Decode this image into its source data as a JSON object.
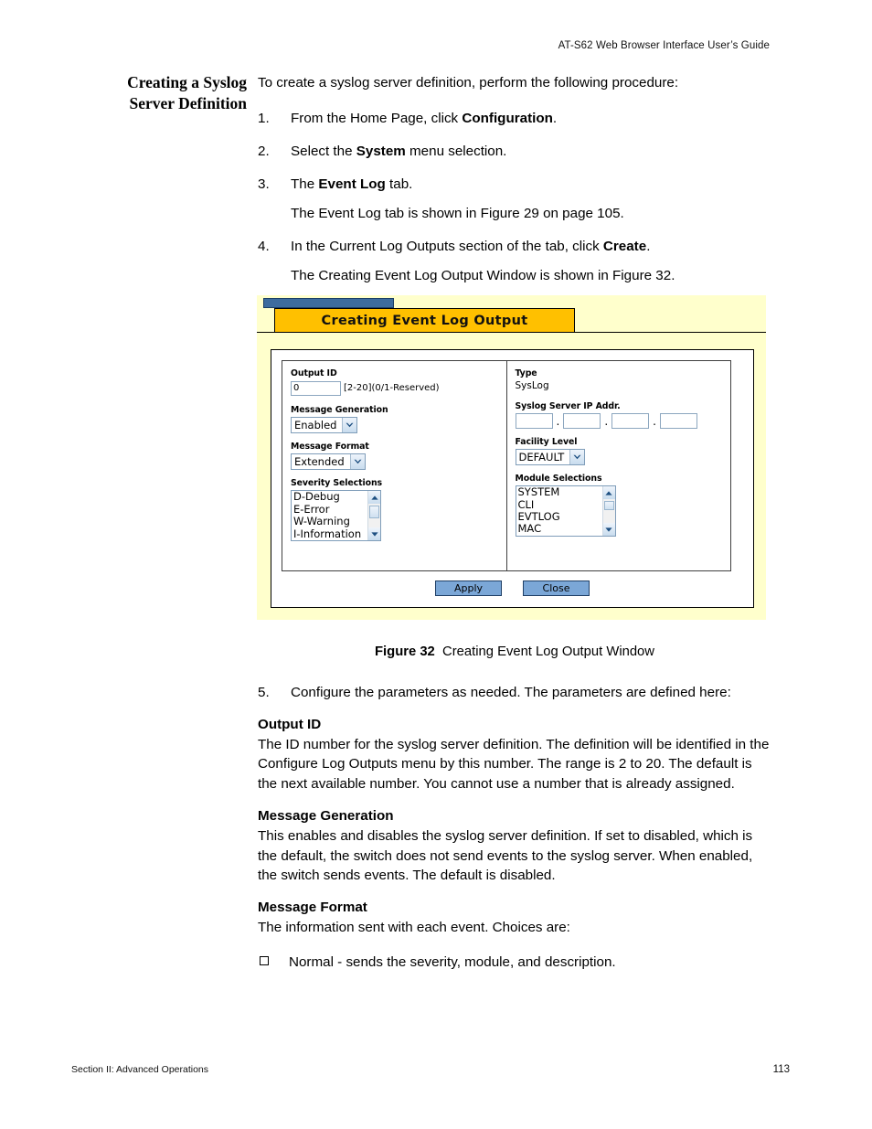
{
  "running_head": "AT-S62 Web Browser Interface User’s Guide",
  "side_heading_line1": "Creating a Syslog",
  "side_heading_line2": "Server Definition",
  "intro": "To create a syslog server definition, perform the following procedure:",
  "steps": [
    {
      "num": "1.",
      "pre": "From the Home Page, click ",
      "bold": "Configuration",
      "post": "."
    },
    {
      "num": "2.",
      "pre": "Select the ",
      "bold": "System",
      "post": " menu selection."
    },
    {
      "num": "3.",
      "pre": "The ",
      "bold": "Event Log",
      "post": " tab.",
      "sub": "The Event Log tab is shown in Figure 29 on page 105."
    },
    {
      "num": "4.",
      "pre": "In the Current Log Outputs section of the tab, click ",
      "bold": "Create",
      "post": ".",
      "sub": "The Creating Event Log Output Window is shown in Figure 32."
    }
  ],
  "figure": {
    "tab_title": "Creating Event Log Output",
    "left": {
      "output_id": {
        "label": "Output ID",
        "value": "0",
        "hint": "[2-20](0/1-Reserved)"
      },
      "message_generation": {
        "label": "Message Generation",
        "value": "Enabled"
      },
      "message_format": {
        "label": "Message Format",
        "value": "Extended"
      },
      "severity_selections": {
        "label": "Severity Selections",
        "items": [
          "D-Debug",
          "E-Error",
          "W-Warning",
          "I-Information"
        ]
      }
    },
    "right": {
      "type": {
        "label": "Type",
        "value": "SysLog"
      },
      "syslog_server_ip": {
        "label": "Syslog Server IP Addr.",
        "octets": [
          "",
          "",
          "",
          ""
        ],
        "separator": "."
      },
      "facility_level": {
        "label": "Facility Level",
        "value": "DEFAULT"
      },
      "module_selections": {
        "label": "Module Selections",
        "items": [
          "SYSTEM",
          "CLI",
          "EVTLOG",
          "MAC"
        ]
      }
    },
    "buttons": {
      "apply": "Apply",
      "close": "Close"
    },
    "colors": {
      "panel_background": "#ffffcc",
      "tab_background": "#ffc000",
      "title_bar": "#3d6c9e",
      "button_face": "#7ba7d7"
    }
  },
  "caption": {
    "number": "Figure 32",
    "text": "Creating Event Log Output Window"
  },
  "lower": {
    "step5_num": "5.",
    "step5_text": "Configure the parameters as needed. The parameters are defined here:",
    "params": [
      {
        "title": "Output ID",
        "text": "The ID number for the syslog server definition. The definition will be identified in the Configure Log Outputs menu by this number. The range is 2 to 20. The default is the next available number. You cannot use a number that is already assigned."
      },
      {
        "title": "Message Generation",
        "text": "This enables and disables the syslog server definition. If set to disabled, which is the default, the switch does not send events to the syslog server. When enabled, the switch sends events. The default is disabled."
      },
      {
        "title": "Message Format",
        "text": "The information sent with each event. Choices are:"
      }
    ],
    "bullets": [
      "Normal - sends the severity, module, and description."
    ]
  },
  "footer": {
    "left": "Section II: Advanced Operations",
    "page": "113"
  }
}
